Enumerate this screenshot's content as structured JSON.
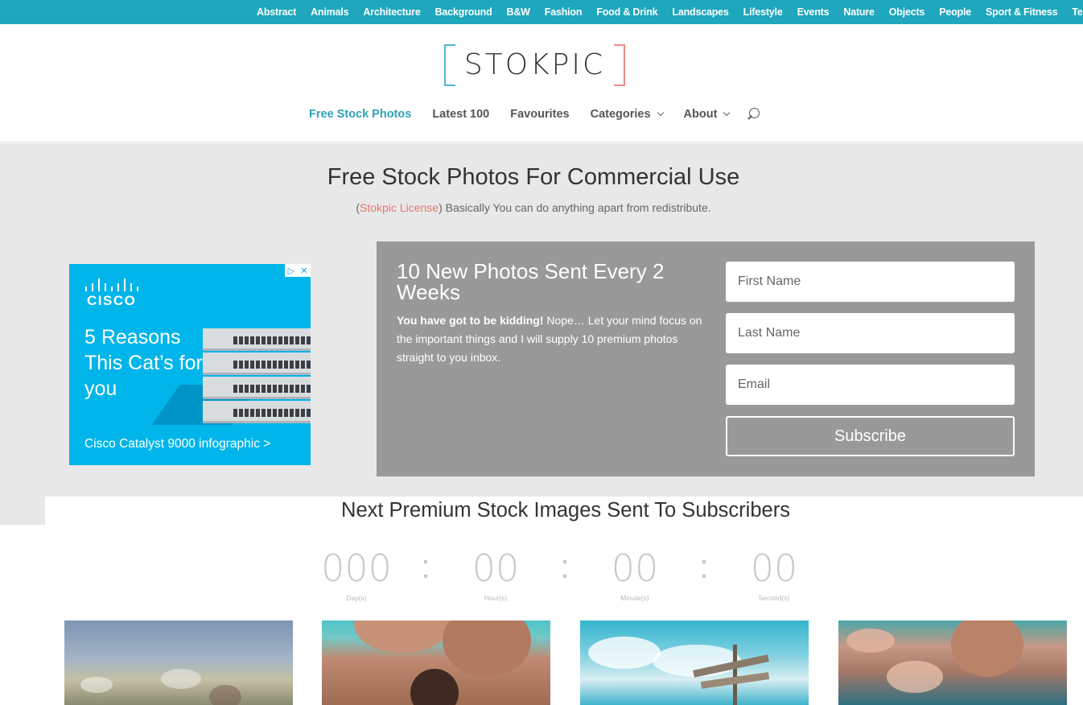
{
  "top_categories": [
    "Abstract",
    "Animals",
    "Architecture",
    "Background",
    "B&W",
    "Fashion",
    "Food & Drink",
    "Landscapes",
    "Lifestyle",
    "Events",
    "Nature",
    "Objects",
    "People",
    "Sport & Fitness",
    "Tech"
  ],
  "logo": {
    "text": "STOKPIC"
  },
  "nav": {
    "free_stock": "Free Stock Photos",
    "latest": "Latest 100",
    "favourites": "Favourites",
    "categories": "Categories",
    "about": "About"
  },
  "hero": {
    "title": "Free Stock Photos For Commercial Use",
    "sub_open": "(",
    "license": "Stokpic License",
    "sub_rest": ") Basically You can do anything apart from redistribute."
  },
  "ad": {
    "brand": "CISCO",
    "headline": "5 Reasons This Cat’s for you",
    "cta": "Cisco Catalyst 9000 infographic >"
  },
  "subscribe": {
    "title": "10 New Photos Sent Every 2 Weeks",
    "desc_bold": "You have got to be kidding!",
    "desc_rest": " Nope… Let your mind focus on the important things and I will supply 10 premium photos straight to you inbox.",
    "first_name_placeholder": "First Name",
    "last_name_placeholder": "Last Name",
    "email_placeholder": "Email",
    "button": "Subscribe"
  },
  "countdown": {
    "title": "Next Premium Stock Images Sent To Subscribers",
    "days": "000",
    "days_label": "Day(s)",
    "hours": "00",
    "hours_label": "Hour(s)",
    "minutes": "00",
    "minutes_label": "Minute(s)",
    "seconds": "00",
    "seconds_label": "Second(s)",
    "separator": ":"
  },
  "colors": {
    "topbar": "#1fa7bd",
    "accent": "#2ea3b6",
    "license": "#e8776f",
    "subscribe_bg": "#999999",
    "ad_bg": "#00b5ea"
  }
}
